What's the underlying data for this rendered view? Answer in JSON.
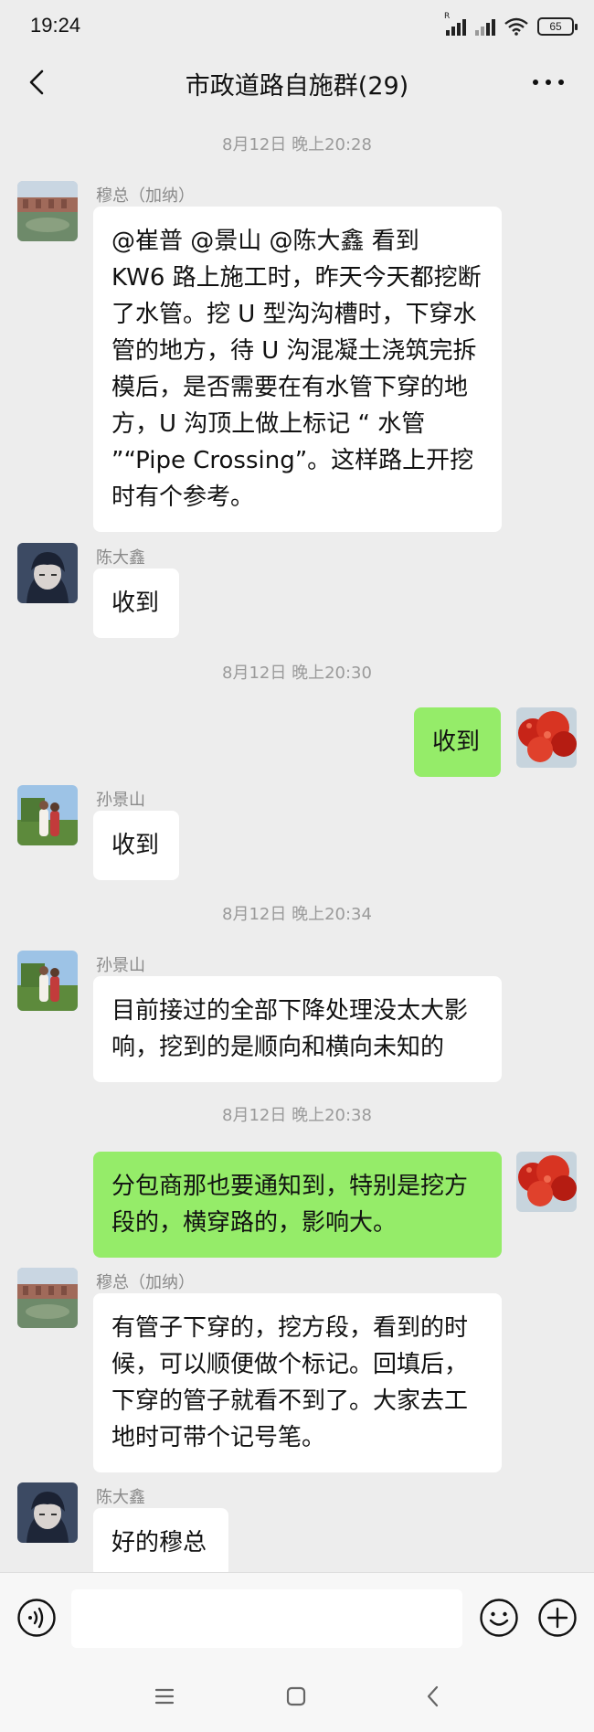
{
  "status_bar": {
    "time": "19:24",
    "battery": "65"
  },
  "header": {
    "title": "市政道路自施群(29)"
  },
  "messages": [
    {
      "timestamp": "8月12日 晚上20:28"
    },
    {
      "sender": "穆总（加纳）",
      "lines": [
        "@崔普  @景山  @陈大鑫  看到",
        "KW6 路上施工时，昨天今天都挖断",
        "了水管。挖 U 型沟沟槽时，下穿水",
        "管的地方，待 U 沟混凝土浇筑完拆",
        "模后，是否需要在有水管下穿的地",
        "方，U 沟顶上做上标记 “ 水管",
        "”“Pipe Crossing”。这样路上开挖",
        "时有个参考。"
      ]
    },
    {
      "sender": "陈大鑫",
      "lines": [
        "收到"
      ]
    },
    {
      "timestamp": "8月12日 晚上20:30"
    },
    {
      "lines": [
        "收到"
      ]
    },
    {
      "sender": "孙景山",
      "lines": [
        "收到"
      ]
    },
    {
      "timestamp": "8月12日 晚上20:34"
    },
    {
      "sender": "孙景山",
      "lines": [
        "目前接过的全部下降处理没太大影",
        "响，挖到的是顺向和横向未知的"
      ]
    },
    {
      "timestamp": "8月12日 晚上20:38"
    },
    {
      "lines": [
        "分包商那也要通知到，特别是挖方",
        "段的，横穿路的，影响大。"
      ]
    },
    {
      "sender": "穆总（加纳）",
      "lines": [
        "有管子下穿的，挖方段，看到的时",
        "候，可以顺便做个标记。回填后，",
        "下穿的管子就看不到了。大家去工",
        "地时可带个记号笔。"
      ]
    },
    {
      "sender": "陈大鑫",
      "lines": [
        "好的穆总"
      ]
    }
  ],
  "input": {
    "placeholder": ""
  },
  "colors": {
    "background": "#ededed",
    "sent_bubble": "#95ec69",
    "received_bubble": "#ffffff",
    "timestamp_text": "#9a9a9a"
  },
  "icons": {
    "back": "chevron-left-icon",
    "more": "more-dots-icon",
    "voice": "voice-icon",
    "emoji": "emoji-icon",
    "plus": "plus-icon",
    "nav_menu": "menu-icon",
    "nav_home": "home-icon",
    "nav_back": "nav-back-icon"
  }
}
